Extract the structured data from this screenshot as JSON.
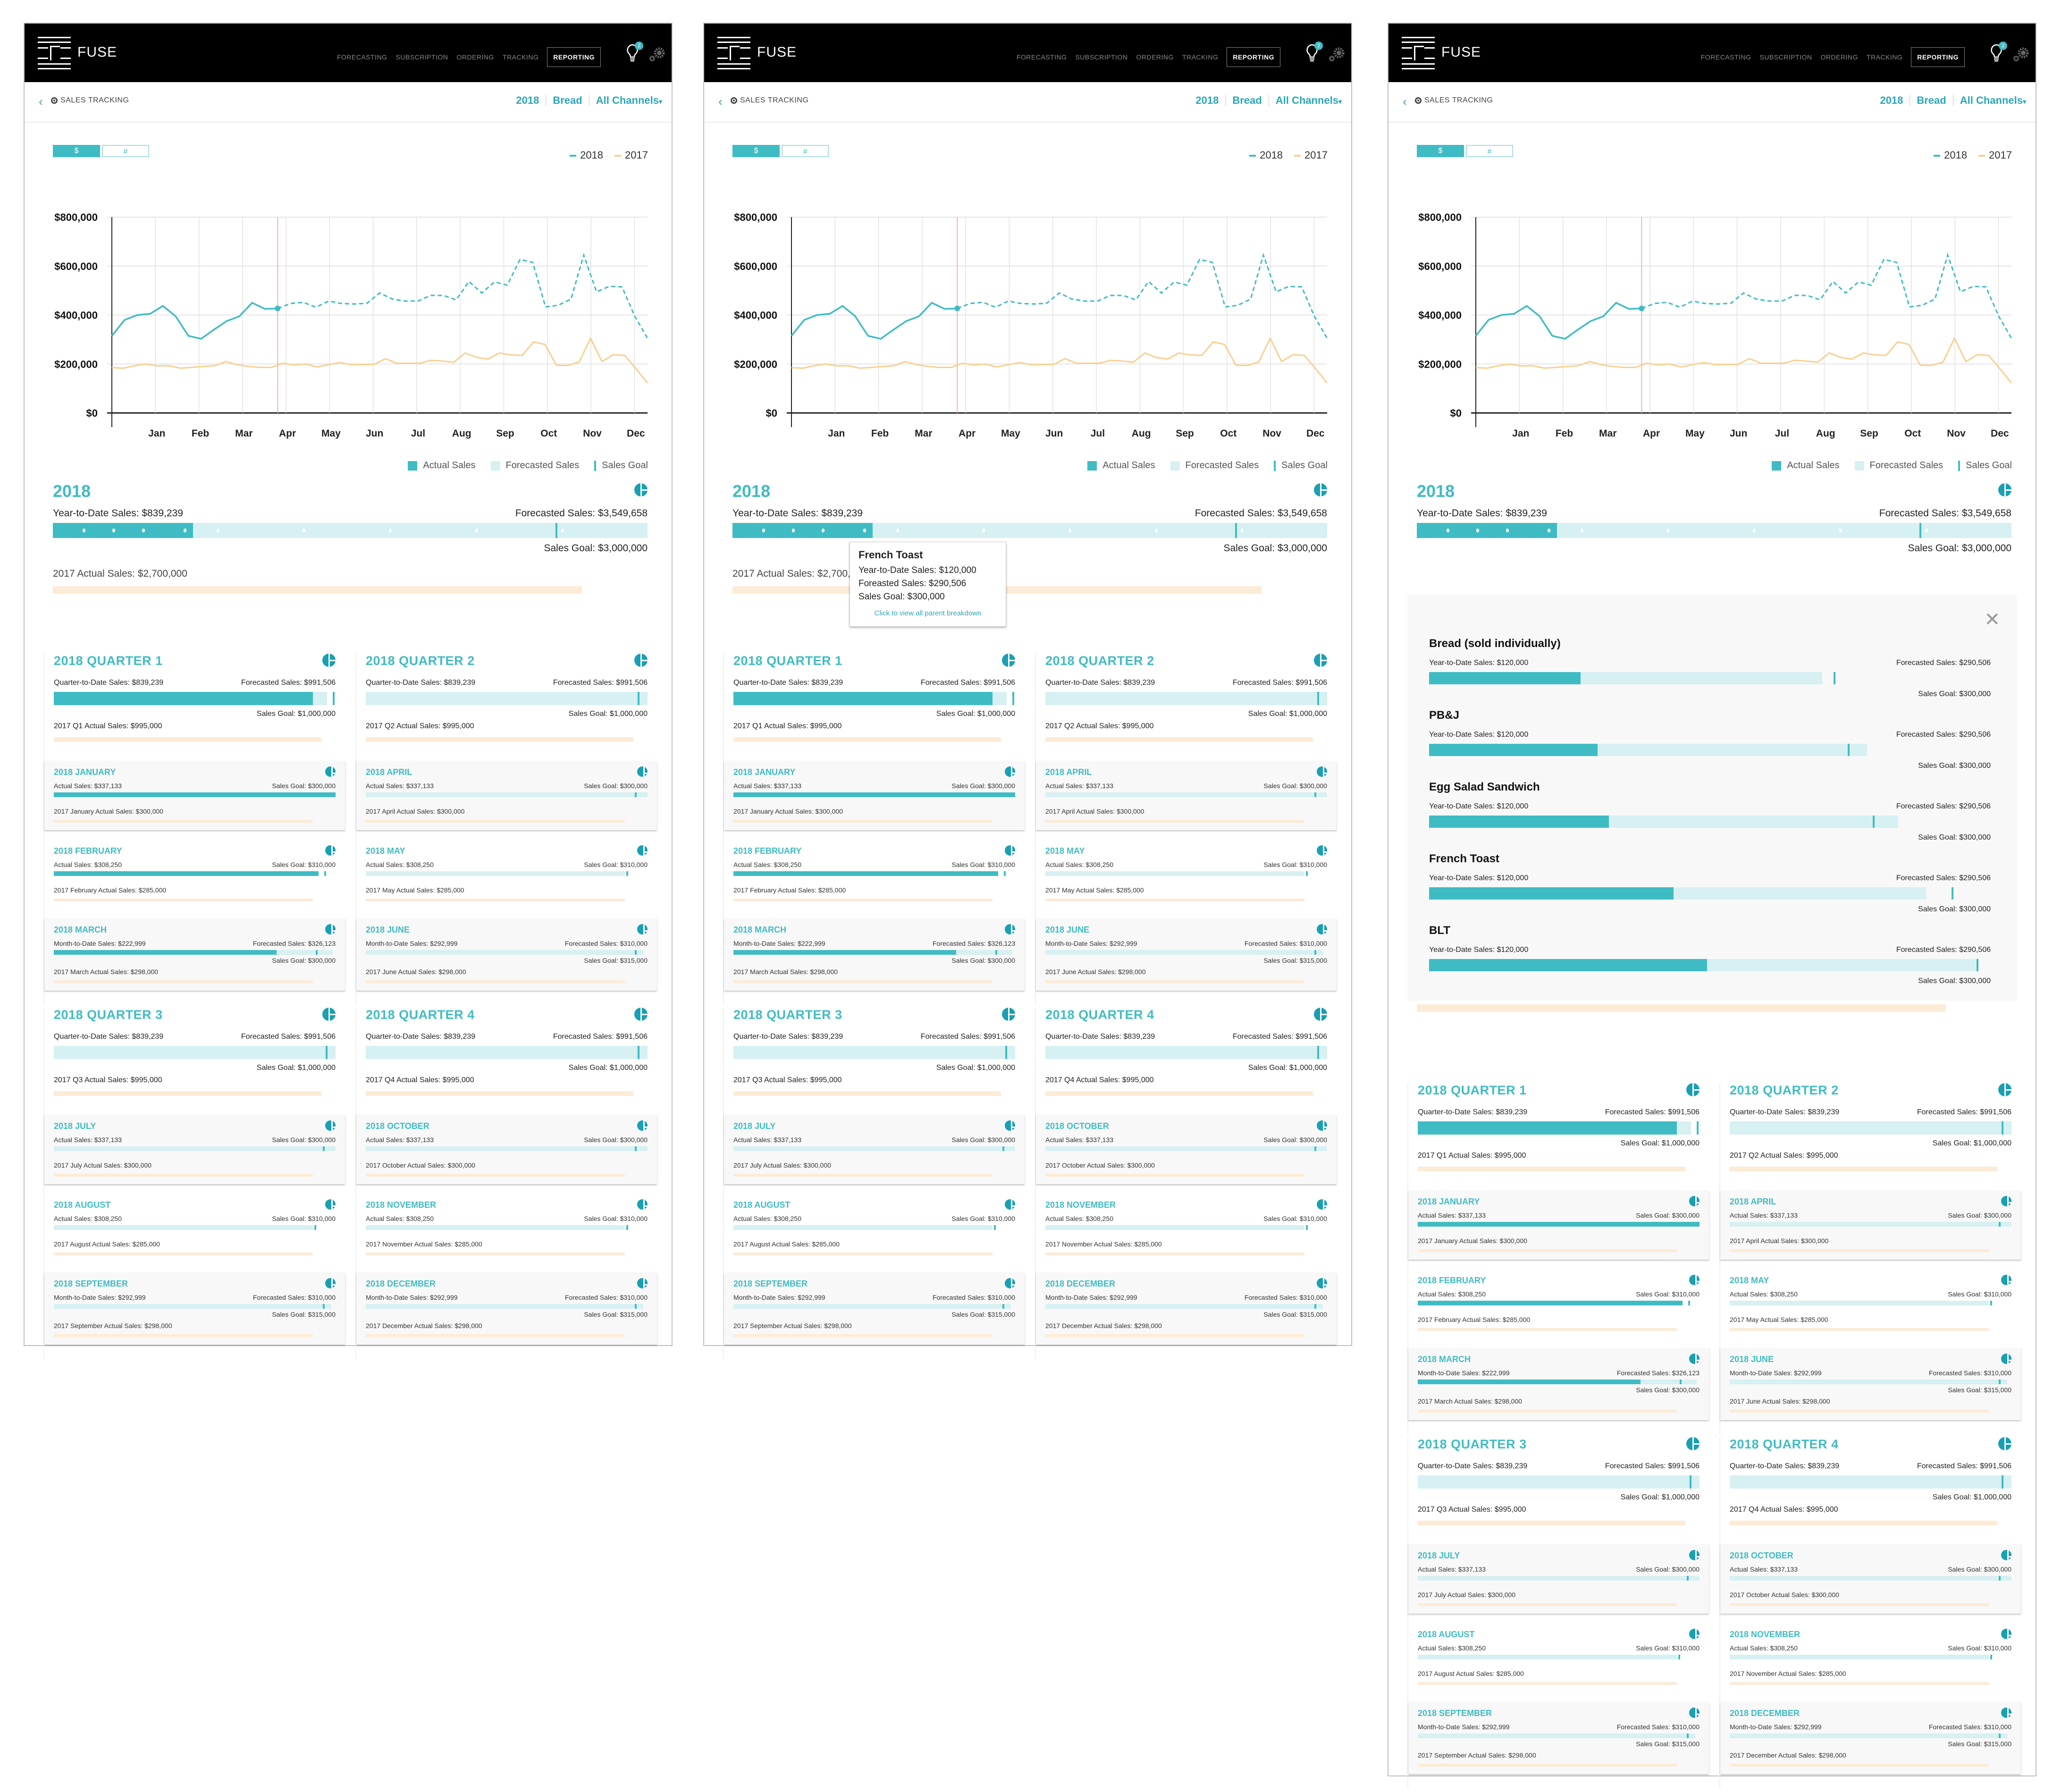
{
  "app": {
    "brand": "FUSE",
    "nav": [
      "FORECASTING",
      "SUBSCRIPTION",
      "ORDERING",
      "TRACKING"
    ],
    "nav_active": "REPORTING",
    "notification_count": "2",
    "icons": {
      "logo": "fuse-logo-icon",
      "bulb": "lightbulb-icon",
      "settings": "gears-icon",
      "back": "chevron-left-icon",
      "target": "target-icon",
      "pie": "pie-chart-icon",
      "close": "close-icon"
    }
  },
  "subheader": {
    "back_glyph": "‹",
    "title": "SALES TRACKING",
    "year": "2018",
    "category": "Bread",
    "channel": "All Channels",
    "channel_caret": "▾"
  },
  "toggles": {
    "dollar": "$",
    "count": "#"
  },
  "colors": {
    "accent": "#3fbcc3",
    "accent_light": "#d7f0f2",
    "prior_year": "#f9cf8f",
    "prior_year_bar": "#fcebd6",
    "marker_line": "#f1b5a9",
    "topbar": "#000000"
  },
  "chart_data": {
    "type": "line",
    "title": "",
    "xlabel": "",
    "ylabel": "",
    "ylim": [
      0,
      800000
    ],
    "yticks": [
      "$0",
      "$200,000",
      "$400,000",
      "$600,000",
      "$800,000"
    ],
    "ytick_values": [
      0,
      200000,
      400000,
      600000,
      800000
    ],
    "categories": [
      "Jan",
      "Feb",
      "Mar",
      "Apr",
      "May",
      "Jun",
      "Jul",
      "Aug",
      "Sep",
      "Oct",
      "Nov",
      "Dec"
    ],
    "grid": true,
    "legend": "top-right",
    "current_marker_index": 13,
    "series": [
      {
        "name": "2018",
        "actual_until_index": 13,
        "values": [
          315000,
          380000,
          400000,
          405000,
          437000,
          395000,
          315000,
          303000,
          340000,
          375000,
          395000,
          450000,
          425000,
          427000,
          447000,
          452000,
          432000,
          457000,
          447000,
          445000,
          448000,
          490000,
          465000,
          457000,
          457000,
          480000,
          480000,
          462000,
          537000,
          490000,
          535000,
          522000,
          627000,
          615000,
          433000,
          440000,
          465000,
          645000,
          495000,
          517000,
          515000,
          395000,
          305000
        ]
      },
      {
        "name": "2017",
        "values": [
          185000,
          183000,
          193000,
          200000,
          192000,
          193000,
          183000,
          186000,
          190000,
          193000,
          210000,
          197000,
          190000,
          186000,
          186000,
          203000,
          196000,
          200000,
          188000,
          197000,
          206000,
          197000,
          198000,
          198000,
          222000,
          203000,
          203000,
          203000,
          215000,
          212000,
          207000,
          245000,
          227000,
          220000,
          245000,
          237000,
          235000,
          290000,
          280000,
          195000,
          194000,
          208000,
          305000,
          210000,
          238000,
          235000,
          180000,
          122000
        ]
      }
    ]
  },
  "bar_legend": {
    "actual": "Actual Sales",
    "forecast": "Forecasted Sales",
    "goal": "Sales Goal"
  },
  "year_summary": {
    "title": "2018",
    "ytd": "Year-to-Date Sales: $839,239",
    "forecast": "Forecasted Sales: $3,549,658",
    "goal": "Sales Goal: $3,000,000",
    "prev": "2017 Actual Sales: $2,700,000",
    "actual_fraction": 0.236,
    "goal_fraction": 0.845,
    "prev_fraction": 0.89
  },
  "quarters": [
    {
      "title": "2018 QUARTER 1",
      "qtd": "Quarter-to-Date Sales: $839,239",
      "forecast": "Forecasted Sales: $991,506",
      "goal": "Sales Goal: $1,000,000",
      "prev": "2017 Q1 Actual Sales: $995,000",
      "actual_fraction": 0.92,
      "forecast_fraction": 0.97,
      "goal_fraction": 0.99,
      "months": [
        {
          "title": "2018 JANUARY",
          "left": "Actual Sales: $337,133",
          "right": "Sales Goal: $300,000",
          "sub": "",
          "prev": "2017 January Actual Sales: $300,000",
          "actual_fraction": 1.0,
          "goal_fraction": 0.92,
          "forecast_fraction": 1.0
        },
        {
          "title": "2018 FEBRUARY",
          "left": "Actual Sales: $308,250",
          "right": "Sales Goal: $310,000",
          "sub": "",
          "prev": "2017 February Actual Sales: $285,000",
          "actual_fraction": 0.94,
          "goal_fraction": 0.96,
          "forecast_fraction": 0.94
        },
        {
          "title": "2018 MARCH",
          "left": "Month-to-Date Sales: $222,999",
          "right": "Forecasted Sales: $326,123",
          "sub": "Sales Goal: $300,000",
          "prev": "2017 March Actual Sales: $298,000",
          "actual_fraction": 0.79,
          "goal_fraction": 0.93,
          "forecast_fraction": 0.99
        }
      ]
    },
    {
      "title": "2018 QUARTER 2",
      "qtd": "Quarter-to-Date Sales: $839,239",
      "forecast": "Forecasted Sales: $991,506",
      "goal": "Sales Goal: $1,000,000",
      "prev": "2017 Q2 Actual Sales: $995,000",
      "actual_fraction": 0,
      "forecast_fraction": 1.0,
      "goal_fraction": 0.965,
      "months": [
        {
          "title": "2018 APRIL",
          "left": "Actual Sales: $337,133",
          "right": "Sales Goal: $300,000",
          "sub": "",
          "prev": "2017 April Actual Sales: $300,000",
          "actual_fraction": 0,
          "goal_fraction": 0.955,
          "forecast_fraction": 1.0
        },
        {
          "title": "2018 MAY",
          "left": "Actual Sales: $308,250",
          "right": "Sales Goal: $310,000",
          "sub": "",
          "prev": "2017 May Actual Sales: $285,000",
          "actual_fraction": 0,
          "goal_fraction": 0.925,
          "forecast_fraction": 0.92
        },
        {
          "title": "2018 JUNE",
          "left": "Month-to-Date Sales: $292,999",
          "right": "Forecasted Sales: $310,000",
          "sub": "Sales Goal: $315,000",
          "prev": "2017 June Actual Sales: $298,000",
          "actual_fraction": 0,
          "goal_fraction": 0.955,
          "forecast_fraction": 0.985
        }
      ]
    },
    {
      "title": "2018 QUARTER 3",
      "qtd": "Quarter-to-Date Sales: $839,239",
      "forecast": "Forecasted Sales: $991,506",
      "goal": "Sales Goal: $1,000,000",
      "prev": "2017 Q3 Actual Sales: $995,000",
      "actual_fraction": 0,
      "forecast_fraction": 1.0,
      "goal_fraction": 0.965,
      "months": [
        {
          "title": "2018 JULY",
          "left": "Actual Sales: $337,133",
          "right": "Sales Goal: $300,000",
          "sub": "",
          "prev": "2017 July Actual Sales: $300,000",
          "actual_fraction": 0,
          "goal_fraction": 0.955,
          "forecast_fraction": 1.0
        },
        {
          "title": "2018 AUGUST",
          "left": "Actual Sales: $308,250",
          "right": "Sales Goal: $310,000",
          "sub": "",
          "prev": "2017 August Actual Sales: $285,000",
          "actual_fraction": 0,
          "goal_fraction": 0.925,
          "forecast_fraction": 0.92
        },
        {
          "title": "2018 SEPTEMBER",
          "left": "Month-to-Date Sales: $292,999",
          "right": "Forecasted Sales: $310,000",
          "sub": "Sales Goal: $315,000",
          "prev": "2017 September Actual Sales: $298,000",
          "actual_fraction": 0,
          "goal_fraction": 0.955,
          "forecast_fraction": 0.985
        }
      ]
    },
    {
      "title": "2018 QUARTER 4",
      "qtd": "Quarter-to-Date Sales: $839,239",
      "forecast": "Forecasted Sales: $991,506",
      "goal": "Sales Goal: $1,000,000",
      "prev": "2017 Q4 Actual Sales: $995,000",
      "actual_fraction": 0,
      "forecast_fraction": 1.0,
      "goal_fraction": 0.965,
      "months": [
        {
          "title": "2018 OCTOBER",
          "left": "Actual Sales: $337,133",
          "right": "Sales Goal: $300,000",
          "sub": "",
          "prev": "2017 October Actual Sales: $300,000",
          "actual_fraction": 0,
          "goal_fraction": 0.955,
          "forecast_fraction": 1.0
        },
        {
          "title": "2018 NOVEMBER",
          "left": "Actual Sales: $308,250",
          "right": "Sales Goal: $310,000",
          "sub": "",
          "prev": "2017 November Actual Sales: $285,000",
          "actual_fraction": 0,
          "goal_fraction": 0.925,
          "forecast_fraction": 0.92
        },
        {
          "title": "2018 DECEMBER",
          "left": "Month-to-Date Sales: $292,999",
          "right": "Forecasted Sales: $310,000",
          "sub": "Sales Goal: $315,000",
          "prev": "2017 December Actual Sales: $298,000",
          "actual_fraction": 0,
          "goal_fraction": 0.955,
          "forecast_fraction": 0.985
        }
      ]
    }
  ],
  "tooltip": {
    "title": "French Toast",
    "ytd": "Year-to-Date Sales: $120,000",
    "forecast": "Foreasted Sales: $290,506",
    "goal": "Sales Goal: $300,000",
    "link": "Click to view all parent breakdown"
  },
  "breakdown": {
    "close_glyph": "✕",
    "items": [
      {
        "name": "Bread (sold individually)",
        "ytd": "Year-to-Date Sales: $120,000",
        "forecast": "Forecasted Sales: $290,506",
        "goal": "Sales Goal: $300,000",
        "actual_fraction": 0.27,
        "forecast_fraction": 0.7,
        "goal_fraction": 0.72
      },
      {
        "name": "PB&J",
        "ytd": "Year-to-Date Sales: $120,000",
        "forecast": "Forecasted Sales: $290,506",
        "goal": "Sales Goal: $300,000",
        "actual_fraction": 0.3,
        "forecast_fraction": 0.78,
        "goal_fraction": 0.745
      },
      {
        "name": "Egg Salad Sandwich",
        "ytd": "Year-to-Date Sales: $120,000",
        "forecast": "Forecasted Sales: $290,506",
        "goal": "Sales Goal: $300,000",
        "actual_fraction": 0.32,
        "forecast_fraction": 0.835,
        "goal_fraction": 0.79
      },
      {
        "name": "French Toast",
        "ytd": "Year-to-Date Sales: $120,000",
        "forecast": "Forecasted Sales: $290,506",
        "goal": "Sales Goal: $300,000",
        "actual_fraction": 0.435,
        "forecast_fraction": 0.885,
        "goal_fraction": 0.93
      },
      {
        "name": "BLT",
        "ytd": "Year-to-Date Sales: $120,000",
        "forecast": "Forecasted Sales: $290,506",
        "goal": "Sales Goal: $300,000",
        "actual_fraction": 0.495,
        "forecast_fraction": 0.975,
        "goal_fraction": 0.975
      }
    ]
  }
}
